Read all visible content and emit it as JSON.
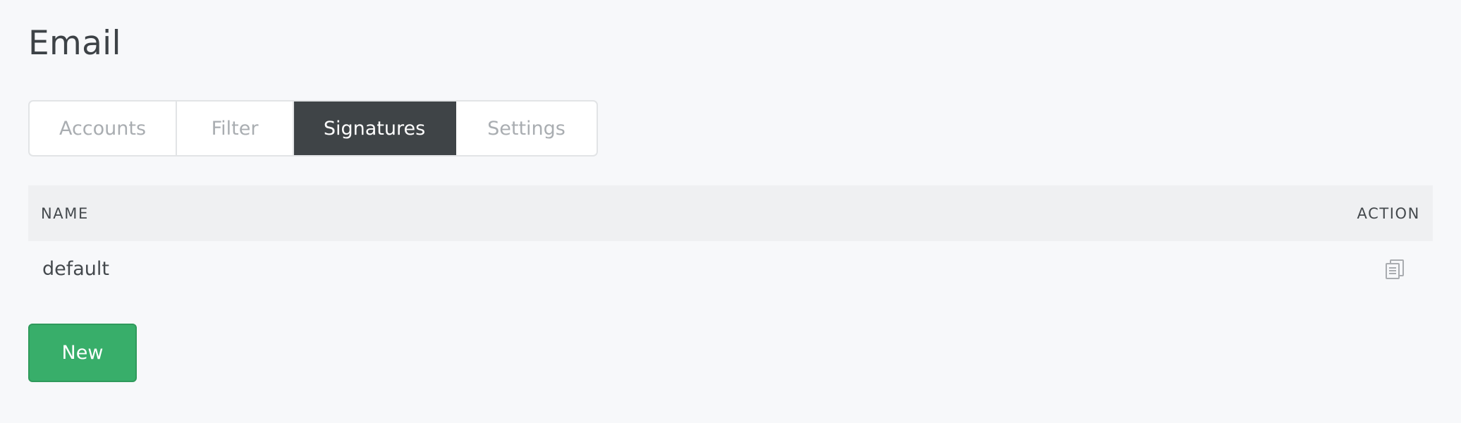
{
  "page": {
    "title": "Email"
  },
  "tabs": [
    {
      "label": "Accounts",
      "active": false
    },
    {
      "label": "Filter",
      "active": false
    },
    {
      "label": "Signatures",
      "active": true
    },
    {
      "label": "Settings",
      "active": false
    }
  ],
  "table": {
    "columns": {
      "name": "NAME",
      "action": "ACTION"
    },
    "rows": [
      {
        "name": "default",
        "action_icon": "clone-icon"
      }
    ]
  },
  "buttons": {
    "new_label": "New"
  },
  "colors": {
    "background": "#f7f8fa",
    "active_tab": "#3f4447",
    "primary_button": "#38ae6a",
    "header_row": "#eff0f2"
  }
}
